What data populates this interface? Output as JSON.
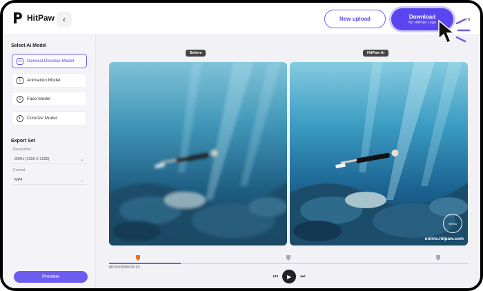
{
  "header": {
    "logo_text": "HitPaw",
    "back_icon": "chevron-left-icon",
    "new_upload": "New upload",
    "download": "Download",
    "download_sub": "No HitPaw Logo",
    "user_fragment": "in"
  },
  "sidebar": {
    "model_title": "Select Ai Model",
    "models": [
      {
        "label": "General Denoise Model",
        "icon": "image-icon",
        "active": true
      },
      {
        "label": "Animation Model",
        "icon": "bear-icon",
        "active": false
      },
      {
        "label": "Face Model",
        "icon": "face-icon",
        "active": false
      },
      {
        "label": "Colorize Model",
        "icon": "palette-icon",
        "active": false
      }
    ],
    "export_title": "Export Set",
    "resolution_label": "Resolution",
    "resolution_value": "200% (1200 X 1200)",
    "format_label": "Format",
    "format_value": "MP4",
    "preview": "Preview"
  },
  "main": {
    "before_label": "Before",
    "after_label": "HitPaw AI",
    "watermark_url": "online.hitpaw.com",
    "watermark_seal": "HitPaw",
    "time": "00:00:05/00:00:13",
    "progress": 0.2
  },
  "colors": {
    "accent": "#6d5cf0",
    "marker": "#f26b1d"
  }
}
